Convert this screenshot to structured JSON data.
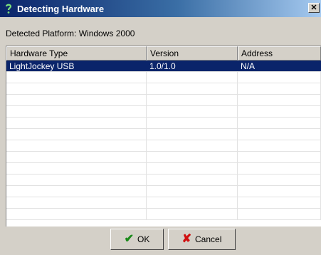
{
  "window": {
    "title": "Detecting Hardware"
  },
  "platform_label": "Detected Platform: Windows 2000",
  "columns": [
    "Hardware Type",
    "Version",
    "Address"
  ],
  "rows": [
    {
      "type": "LightJockey USB",
      "version": "1.0/1.0",
      "address": "N/A"
    }
  ],
  "buttons": {
    "ok": "OK",
    "cancel": "Cancel"
  },
  "icons": {
    "title": "question-mark-icon",
    "close": "close-icon",
    "ok": "checkmark-icon",
    "cancel": "x-icon"
  },
  "colors": {
    "titlebar_start": "#0a246a",
    "titlebar_end": "#a6caf0",
    "selection": "#0a246a",
    "dialog_bg": "#d4d0c8"
  }
}
